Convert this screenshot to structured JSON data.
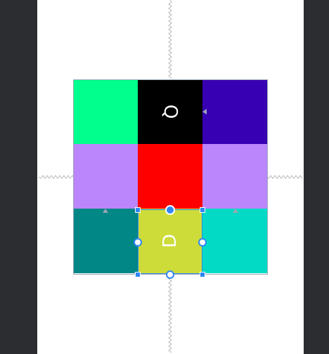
{
  "editor": {
    "background": "#2b2d30",
    "canvas_color": "#ffffff",
    "selection_color": "#2f86f6",
    "constraint_line_color": "#b8b8b8"
  },
  "grid": {
    "cells": [
      {
        "name": "cell-green",
        "color": "#00ff8c",
        "label": ""
      },
      {
        "name": "cell-black",
        "color": "#000000",
        "label": "Q"
      },
      {
        "name": "cell-indigo",
        "color": "#3700b3",
        "label": ""
      },
      {
        "name": "cell-lavender-left",
        "color": "#bb86fc",
        "label": ""
      },
      {
        "name": "cell-red",
        "color": "#ff0000",
        "label": ""
      },
      {
        "name": "cell-lavender-right",
        "color": "#bb86fc",
        "label": ""
      },
      {
        "name": "cell-teal",
        "color": "#018786",
        "label": ""
      },
      {
        "name": "cell-lime-selected",
        "color": "#cddc39",
        "label": "D"
      },
      {
        "name": "cell-cyan",
        "color": "#03dac5",
        "label": ""
      }
    ],
    "selected_index": 7
  },
  "icons": {
    "arrow_up": "triangle-up-icon",
    "arrow_left": "triangle-left-icon"
  }
}
